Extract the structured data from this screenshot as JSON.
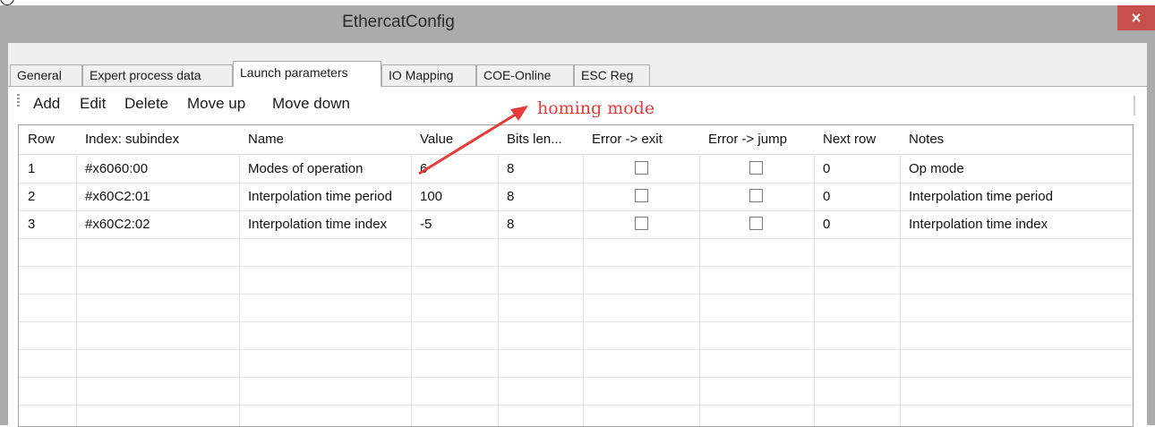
{
  "window": {
    "title": "EthercatConfig",
    "close_glyph": "×"
  },
  "tabs": [
    {
      "label": "General"
    },
    {
      "label": "Expert process data"
    },
    {
      "label": "Launch parameters",
      "active": true
    },
    {
      "label": "IO Mapping"
    },
    {
      "label": "COE-Online"
    },
    {
      "label": "ESC Reg"
    }
  ],
  "toolbar": {
    "add": "Add",
    "edit": "Edit",
    "delete": "Delete",
    "move_up": "Move up",
    "move_down": "Move down"
  },
  "table": {
    "columns": [
      "Row",
      "Index: subindex",
      "Name",
      "Value",
      "Bits len...",
      "Error -> exit",
      "Error -> jump",
      "Next row",
      "Notes"
    ],
    "rows": [
      {
        "row": "1",
        "index": "#x6060:00",
        "name": "Modes of operation",
        "value": "6",
        "bits": "8",
        "error_exit": false,
        "error_jump": false,
        "next_row": "0",
        "notes": "Op mode"
      },
      {
        "row": "2",
        "index": "#x60C2:01",
        "name": "Interpolation time period",
        "value": "100",
        "bits": "8",
        "error_exit": false,
        "error_jump": false,
        "next_row": "0",
        "notes": "Interpolation time period"
      },
      {
        "row": "3",
        "index": "#x60C2:02",
        "name": "Interpolation time index",
        "value": "-5",
        "bits": "8",
        "error_exit": false,
        "error_jump": false,
        "next_row": "0",
        "notes": "Interpolation time index"
      }
    ]
  },
  "annotation": {
    "text": "homing mode",
    "color": "#e53b3b"
  },
  "colors": {
    "window_frame": "#ababab",
    "close_button": "#c7504a",
    "panel": "#f0f0f0"
  }
}
